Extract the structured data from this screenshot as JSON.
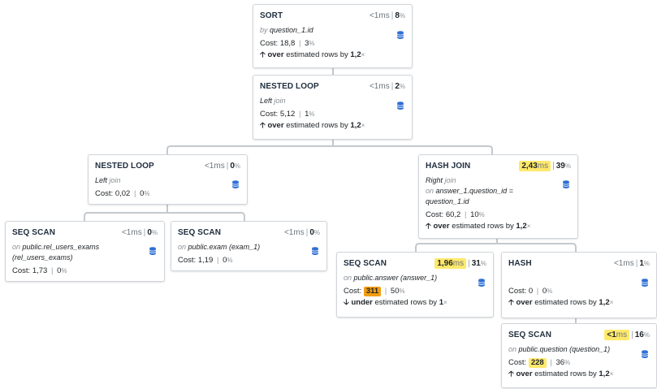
{
  "nodes": {
    "sort": {
      "type": "SORT",
      "duration": "<1",
      "duration_unit": "ms",
      "percent": "8",
      "percent_sign": "%",
      "desc_prefix": "by",
      "desc_key": "question_1.id",
      "cost_label": "Cost:",
      "cost": "18,8",
      "cost_percent": "3",
      "cost_percent_sign": "%",
      "est_arrow": "🡡",
      "est_dir": "over",
      "est_text": "estimated rows by",
      "est_factor": "1,2",
      "est_x": "×"
    },
    "nested_loop_1": {
      "type": "NESTED LOOP",
      "duration": "<1",
      "duration_unit": "ms",
      "percent": "2",
      "percent_sign": "%",
      "desc_key": "Left",
      "desc_suffix": "join",
      "cost_label": "Cost:",
      "cost": "5,12",
      "cost_percent": "1",
      "cost_percent_sign": "%",
      "est_arrow": "🡡",
      "est_dir": "over",
      "est_text": "estimated rows by",
      "est_factor": "1,2",
      "est_x": "×"
    },
    "nested_loop_2": {
      "type": "NESTED LOOP",
      "duration": "<1",
      "duration_unit": "ms",
      "percent": "0",
      "percent_sign": "%",
      "desc_key": "Left",
      "desc_suffix": "join",
      "cost_label": "Cost:",
      "cost": "0,02",
      "cost_percent": "0",
      "cost_percent_sign": "%"
    },
    "hash_join": {
      "type": "HASH JOIN",
      "duration": "2,43",
      "duration_unit": "ms",
      "percent": "39",
      "percent_sign": "%",
      "desc_key": "Right",
      "desc_suffix": "join",
      "desc_on": "on",
      "desc_cond": "answer_1.question_id = question_1.id",
      "cost_label": "Cost:",
      "cost": "60,2",
      "cost_percent": "10",
      "cost_percent_sign": "%",
      "est_arrow": "🡡",
      "est_dir": "over",
      "est_text": "estimated rows by",
      "est_factor": "1,2",
      "est_x": "×"
    },
    "seq_scan_rue": {
      "type": "SEQ SCAN",
      "duration": "<1",
      "duration_unit": "ms",
      "percent": "0",
      "percent_sign": "%",
      "desc_on": "on",
      "desc_key": "public.rel_users_exams (rel_users_exams)",
      "cost_label": "Cost:",
      "cost": "1,73",
      "cost_percent": "0",
      "cost_percent_sign": "%"
    },
    "seq_scan_exam": {
      "type": "SEQ SCAN",
      "duration": "<1",
      "duration_unit": "ms",
      "percent": "0",
      "percent_sign": "%",
      "desc_on": "on",
      "desc_key": "public.exam (exam_1)",
      "cost_label": "Cost:",
      "cost": "1,19",
      "cost_percent": "0",
      "cost_percent_sign": "%"
    },
    "seq_scan_answer": {
      "type": "SEQ SCAN",
      "duration": "1,96",
      "duration_unit": "ms",
      "percent": "31",
      "percent_sign": "%",
      "desc_on": "on",
      "desc_key": "public.answer (answer_1)",
      "cost_label": "Cost:",
      "cost": "311",
      "cost_percent": "50",
      "cost_percent_sign": "%",
      "est_arrow": "🡣",
      "est_dir": "under",
      "est_text": "estimated rows by",
      "est_factor": "1",
      "est_x": "×"
    },
    "hash": {
      "type": "HASH",
      "duration": "<1",
      "duration_unit": "ms",
      "percent": "1",
      "percent_sign": "%",
      "cost_label": "Cost:",
      "cost": "0",
      "cost_percent": "0",
      "cost_percent_sign": "%",
      "est_arrow": "🡡",
      "est_dir": "over",
      "est_text": "estimated rows by",
      "est_factor": "1,2",
      "est_x": "×"
    },
    "seq_scan_question": {
      "type": "SEQ SCAN",
      "duration": "<1",
      "duration_unit": "ms",
      "percent": "16",
      "percent_sign": "%",
      "desc_on": "on",
      "desc_key": "public.question (question_1)",
      "cost_label": "Cost:",
      "cost": "228",
      "cost_percent": "36",
      "cost_percent_sign": "%",
      "est_arrow": "🡡",
      "est_dir": "over",
      "est_text": "estimated rows by",
      "est_factor": "1,2",
      "est_x": "×"
    }
  },
  "icons": {
    "node_icon": "database-icon"
  },
  "colors": {
    "highlight_yellow": "#ffe96b",
    "highlight_orange": "#f39c12",
    "db_icon": "#2f6fd6"
  }
}
